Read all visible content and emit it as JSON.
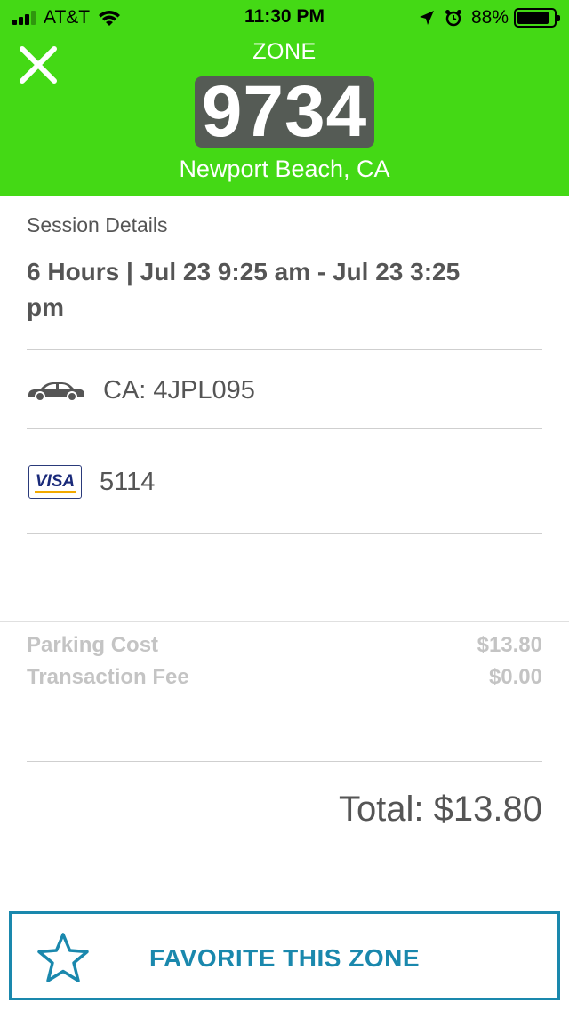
{
  "status_bar": {
    "carrier": "AT&T",
    "time": "11:30 PM",
    "battery_percent": "88%",
    "battery_level": 0.88,
    "signal_bars": 3
  },
  "header": {
    "zone_label": "ZONE",
    "zone_number": "9734",
    "city": "Newport Beach, CA",
    "background_color": "#44d915"
  },
  "session": {
    "label": "Session Details",
    "time_range": "6 Hours | Jul 23 9:25 am - Jul 23 3:25 pm"
  },
  "vehicle": {
    "icon": "car-icon",
    "plate": "CA: 4JPL095"
  },
  "payment": {
    "card_brand": "VISA",
    "card_last4": "5114"
  },
  "fees": [
    {
      "label": "Parking Cost",
      "amount": "$13.80"
    },
    {
      "label": "Transaction Fee",
      "amount": "$0.00"
    }
  ],
  "total": "Total: $13.80",
  "favorite_button": {
    "label": "FAVORITE THIS ZONE",
    "icon": "star-icon",
    "color": "#1a88ad"
  }
}
